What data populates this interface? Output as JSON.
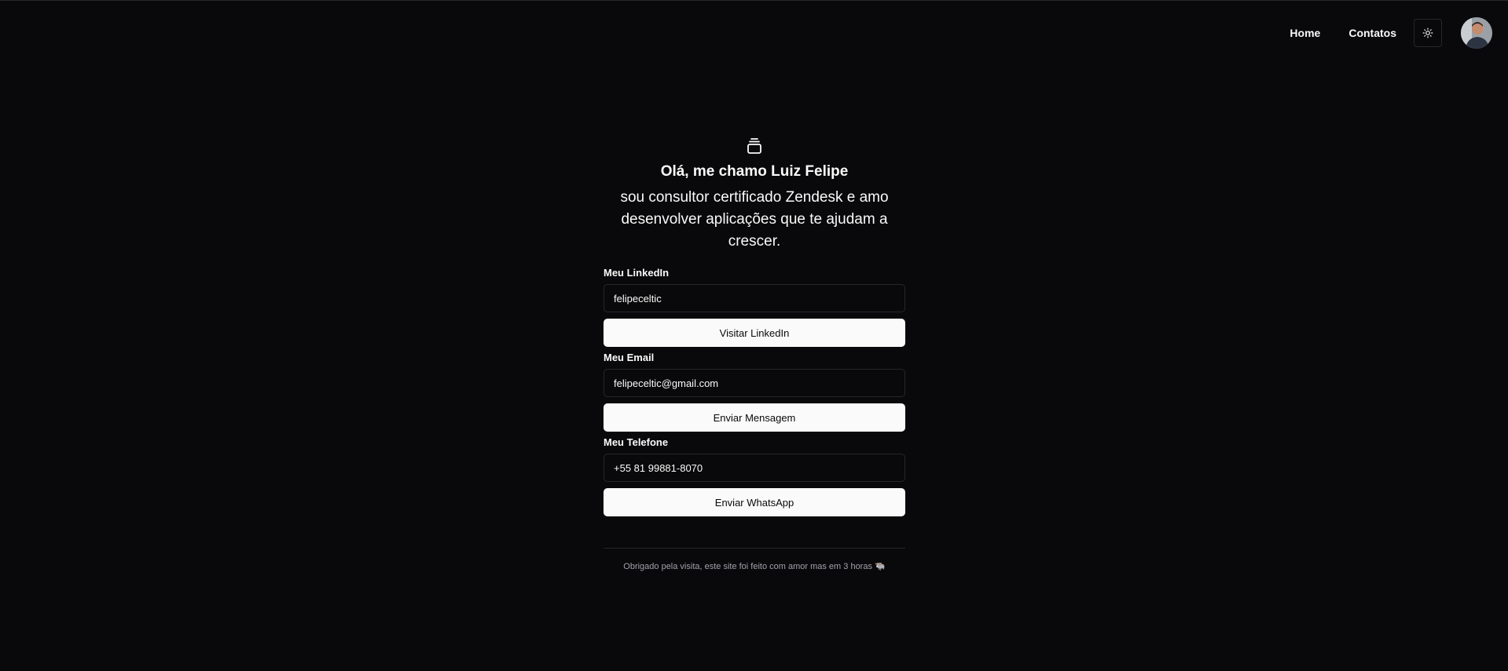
{
  "nav": {
    "home": "Home",
    "contacts": "Contatos",
    "theme_icon": "sun-icon",
    "avatar_icon": "user-avatar"
  },
  "hero": {
    "logo_icon": "layers-icon",
    "headline": "Olá, me chamo Luiz Felipe",
    "subtitle": "sou consultor certificado Zendesk e amo desenvolver aplicações que te ajudam a crescer."
  },
  "contacts": {
    "linkedin_label": "Meu LinkedIn",
    "linkedin_value": "felipeceltic",
    "linkedin_button": "Visitar LinkedIn",
    "email_label": "Meu Email",
    "email_value": "felipeceltic@gmail.com",
    "email_button": "Enviar Mensagem",
    "phone_label": "Meu Telefone",
    "phone_value": "+55 81 99881-8070",
    "phone_button": "Enviar WhatsApp"
  },
  "footer": {
    "text": "Obrigado pela visita, este site foi feito com amor mas em 3 horas 🐃"
  },
  "colors": {
    "background": "#09090b",
    "foreground": "#fafafa",
    "border": "#27272a",
    "muted": "#a1a1aa"
  }
}
